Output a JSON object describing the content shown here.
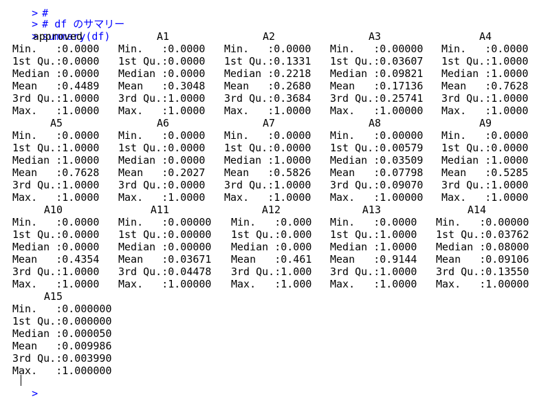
{
  "prompt_symbol": ">",
  "input_lines": [
    {
      "text": "#"
    },
    {
      "text": "# df のサマリー"
    },
    {
      "text": "summary(df)"
    }
  ],
  "columns": [
    {
      "name": "approved",
      "values": [
        "Min.   :0.0000",
        "1st Qu.:0.0000",
        "Median :0.0000",
        "Mean   :0.4489",
        "3rd Qu.:1.0000",
        "Max.   :1.0000"
      ]
    },
    {
      "name": "A1",
      "values": [
        "Min.   :0.0000",
        "1st Qu.:0.0000",
        "Median :0.0000",
        "Mean   :0.3048",
        "3rd Qu.:1.0000",
        "Max.   :1.0000"
      ]
    },
    {
      "name": "A2",
      "values": [
        "Min.   :0.0000",
        "1st Qu.:0.1331",
        "Median :0.2218",
        "Mean   :0.2680",
        "3rd Qu.:0.3684",
        "Max.   :1.0000"
      ]
    },
    {
      "name": "A3",
      "values": [
        "Min.   :0.00000",
        "1st Qu.:0.03607",
        "Median :0.09821",
        "Mean   :0.17136",
        "3rd Qu.:0.25741",
        "Max.   :1.00000"
      ]
    },
    {
      "name": "A4",
      "values": [
        "Min.   :0.0000",
        "1st Qu.:1.0000",
        "Median :1.0000",
        "Mean   :0.7628",
        "3rd Qu.:1.0000",
        "Max.   :1.0000"
      ]
    },
    {
      "name": "A5",
      "values": [
        "Min.   :0.0000",
        "1st Qu.:1.0000",
        "Median :1.0000",
        "Mean   :0.7628",
        "3rd Qu.:1.0000",
        "Max.   :1.0000"
      ]
    },
    {
      "name": "A6",
      "values": [
        "Min.   :0.0000",
        "1st Qu.:0.0000",
        "Median :0.0000",
        "Mean   :0.2027",
        "3rd Qu.:0.0000",
        "Max.   :1.0000"
      ]
    },
    {
      "name": "A7",
      "values": [
        "Min.   :0.0000",
        "1st Qu.:0.0000",
        "Median :1.0000",
        "Mean   :0.5826",
        "3rd Qu.:1.0000",
        "Max.   :1.0000"
      ]
    },
    {
      "name": "A8",
      "values": [
        "Min.   :0.00000",
        "1st Qu.:0.00579",
        "Median :0.03509",
        "Mean   :0.07798",
        "3rd Qu.:0.09070",
        "Max.   :1.00000"
      ]
    },
    {
      "name": "A9",
      "values": [
        "Min.   :0.0000",
        "1st Qu.:0.0000",
        "Median :1.0000",
        "Mean   :0.5285",
        "3rd Qu.:1.0000",
        "Max.   :1.0000"
      ]
    },
    {
      "name": "A10",
      "values": [
        "Min.   :0.0000",
        "1st Qu.:0.0000",
        "Median :0.0000",
        "Mean   :0.4354",
        "3rd Qu.:1.0000",
        "Max.   :1.0000"
      ]
    },
    {
      "name": "A11",
      "values": [
        "Min.   :0.00000",
        "1st Qu.:0.00000",
        "Median :0.00000",
        "Mean   :0.03671",
        "3rd Qu.:0.04478",
        "Max.   :1.00000"
      ]
    },
    {
      "name": "A12",
      "values": [
        "Min.   :0.000",
        "1st Qu.:0.000",
        "Median :0.000",
        "Mean   :0.461",
        "3rd Qu.:1.000",
        "Max.   :1.000"
      ]
    },
    {
      "name": "A13",
      "values": [
        "Min.   :0.0000",
        "1st Qu.:1.0000",
        "Median :1.0000",
        "Mean   :0.9144",
        "3rd Qu.:1.0000",
        "Max.   :1.0000"
      ]
    },
    {
      "name": "A14",
      "values": [
        "Min.   :0.00000",
        "1st Qu.:0.03762",
        "Median :0.08000",
        "Mean   :0.09106",
        "3rd Qu.:0.13550",
        "Max.   :1.00000"
      ]
    },
    {
      "name": "A15",
      "values": [
        "Min.   :0.000000",
        "1st Qu.:0.000000",
        "Median :0.000050",
        "Mean   :0.009986",
        "3rd Qu.:0.003990",
        "Max.   :1.000000"
      ]
    }
  ],
  "colors": {
    "input": "#0000ff",
    "output": "#000000",
    "background": "#ffffff"
  }
}
